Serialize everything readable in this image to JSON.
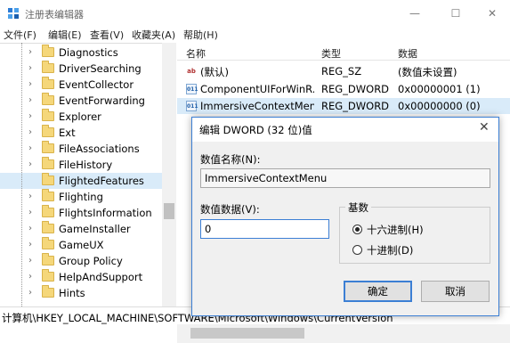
{
  "window": {
    "title": "注册表编辑器",
    "controls": {
      "minimize": "—",
      "maximize": "☐",
      "close": "✕"
    }
  },
  "menu": [
    "文件(F)",
    "编辑(E)",
    "查看(V)",
    "收藏夹(A)",
    "帮助(H)"
  ],
  "tree": {
    "items": [
      "Diagnostics",
      "DriverSearching",
      "EventCollector",
      "EventForwarding",
      "Explorer",
      "Ext",
      "FileAssociations",
      "FileHistory",
      "FlightedFeatures",
      "Flighting",
      "FlightsInformation",
      "GameInstaller",
      "GameUX",
      "Group Policy",
      "HelpAndSupport",
      "Hints"
    ],
    "selected": "FlightedFeatures"
  },
  "values": {
    "headers": [
      "名称",
      "类型",
      "数据"
    ],
    "rows": [
      {
        "icon": "ab",
        "name": "(默认)",
        "type": "REG_SZ",
        "data": "(数值未设置)"
      },
      {
        "icon": "011",
        "name": "ComponentUIForWinR...",
        "type": "REG_DWORD",
        "data": "0x00000001 (1)"
      },
      {
        "icon": "011",
        "name": "ImmersiveContextMenu",
        "type": "REG_DWORD",
        "data": "0x00000000 (0)"
      }
    ]
  },
  "status": "计算机\\HKEY_LOCAL_MACHINE\\SOFTWARE\\Microsoft\\Windows\\CurrentVersion",
  "dialog": {
    "title": "编辑 DWORD (32 位)值",
    "close": "✕",
    "name_label": "数值名称(N):",
    "name_value": "ImmersiveContextMenu",
    "data_label": "数值数据(V):",
    "data_value": "0",
    "base_label": "基数",
    "radio_hex": "十六进制(H)",
    "radio_dec": "十进制(D)",
    "selected_base": "hex",
    "ok": "确定",
    "cancel": "取消"
  },
  "colors": {
    "selection": "#d9ebf9",
    "dialog_border": "#3c7fd4",
    "folder": "#f5d77a"
  }
}
